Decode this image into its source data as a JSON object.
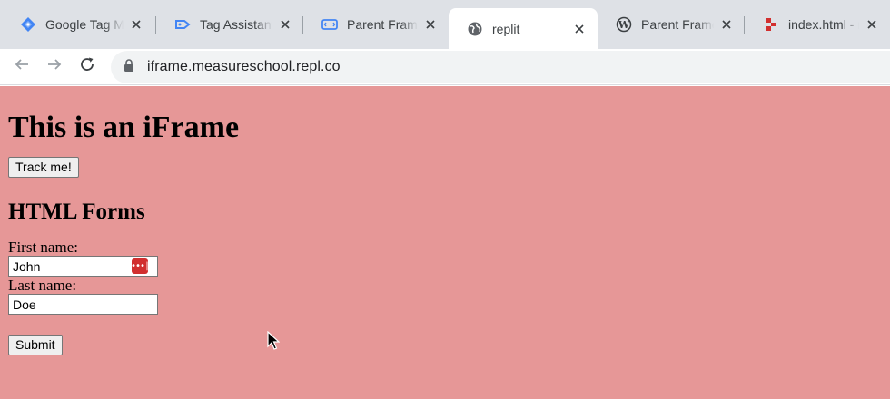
{
  "tabs": [
    {
      "title": "Google Tag Manager",
      "icon": "google-tag-manager-icon",
      "active": false
    },
    {
      "title": "Tag Assistant",
      "icon": "tag-assistant-icon",
      "active": false
    },
    {
      "title": "Parent Frame",
      "icon": "parent-frame-icon",
      "active": false
    },
    {
      "title": "replit",
      "icon": "globe-icon",
      "active": true
    },
    {
      "title": "Parent Frame",
      "icon": "wordpress-icon",
      "active": false
    },
    {
      "title": "index.html - replit",
      "icon": "replit-icon",
      "active": false
    }
  ],
  "address_bar": {
    "url": "iframe.measureschool.repl.co"
  },
  "page": {
    "heading": "This is an iFrame",
    "track_button": "Track me!",
    "forms_heading": "HTML Forms",
    "first_name_label": "First name:",
    "first_name_value": "John",
    "last_name_label": "Last name:",
    "last_name_value": "Doe",
    "submit_button": "Submit",
    "background_color": "#e69797"
  },
  "colors": {
    "tabbar": "#dee1e6",
    "password_manager_badge": "#d12f2f"
  }
}
